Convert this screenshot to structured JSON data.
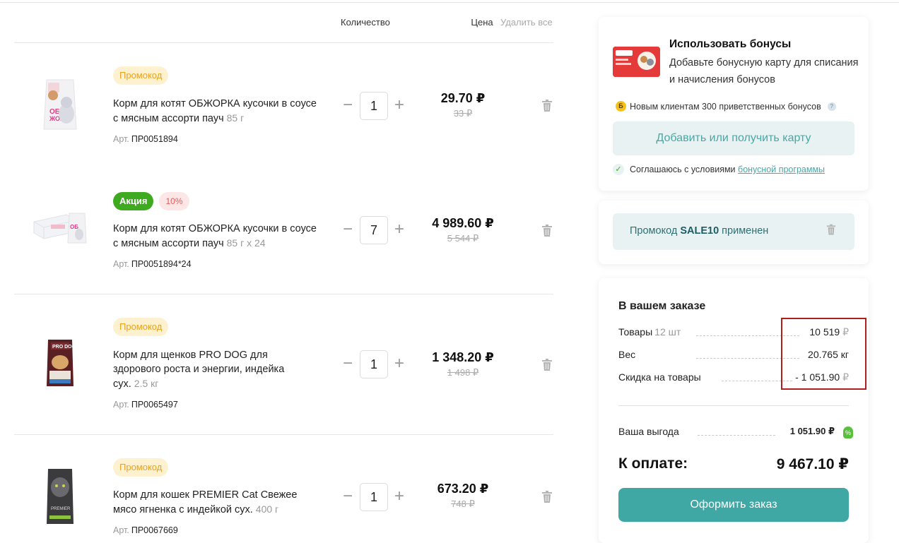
{
  "cart_header": {
    "qty_label": "Количество",
    "price_label": "Цена",
    "delete_all": "Удалить все"
  },
  "items": [
    {
      "badges": [
        "Промокод"
      ],
      "name": "Корм для котят ОБЖОРКА кусочки в соусе с мясным ассорти пауч",
      "weight": "85 г",
      "sku_label": "Арт.",
      "sku": "ПР0051894",
      "qty": "1",
      "price": "29.70 ₽",
      "old_price": "33 ₽"
    },
    {
      "badges": [
        "Акция",
        "10%"
      ],
      "name": "Корм для котят ОБЖОРКА кусочки в соусе с мясным ассорти пауч",
      "weight": "85 г х 24",
      "sku_label": "Арт.",
      "sku": "ПР0051894*24",
      "qty": "7",
      "price": "4 989.60 ₽",
      "old_price": "5 544 ₽"
    },
    {
      "badges": [
        "Промокод"
      ],
      "name": "Корм для щенков PRO DOG для здорового роста и энергии, индейка сух.",
      "weight": "2.5 кг",
      "sku_label": "Арт.",
      "sku": "ПР0065497",
      "qty": "1",
      "price": "1 348.20 ₽",
      "old_price": "1 498 ₽"
    },
    {
      "badges": [
        "Промокод"
      ],
      "name": "Корм для кошек PREMIER Cat Свежее мясо ягненка с индейкой сух.",
      "weight": "400 г",
      "sku_label": "Арт.",
      "sku": "ПР0067669",
      "qty": "1",
      "price": "673.20 ₽",
      "old_price": "748 ₽"
    }
  ],
  "qty_controls": {
    "minus": "−",
    "plus": "+"
  },
  "bonus": {
    "title": "Использовать бонусы",
    "description": "Добавьте бонусную карту для списания и начисления бонусов",
    "coin": "Б",
    "note": "Новым клиентам 300 приветственных бонусов",
    "help": "?",
    "button": "Добавить или получить карту",
    "agree_text": "Соглашаюсь с условиями",
    "agree_link": "бонусной программы",
    "check": "✓"
  },
  "promo": {
    "prefix": "Промокод",
    "code": "SALE10",
    "suffix": "применен"
  },
  "order": {
    "title": "В вашем заказе",
    "goods_label": "Товары",
    "goods_count": "12 шт",
    "goods_value": "10 519",
    "currency": "₽",
    "weight_label": "Вес",
    "weight_value": "20.765 кг",
    "discount_label": "Скидка на товары",
    "discount_value": "- 1 051.90",
    "benefit_label": "Ваша выгода",
    "benefit_value": "1 051.90 ₽",
    "pay_label": "К оплате:",
    "pay_value": "9 467.10 ₽",
    "checkout_button": "Оформить заказ"
  },
  "colors": {
    "accent": "#3fa8a5",
    "promo_badge": "#e8a325",
    "sale_badge": "#3eaa1f",
    "highlight": "#b21e1e"
  }
}
